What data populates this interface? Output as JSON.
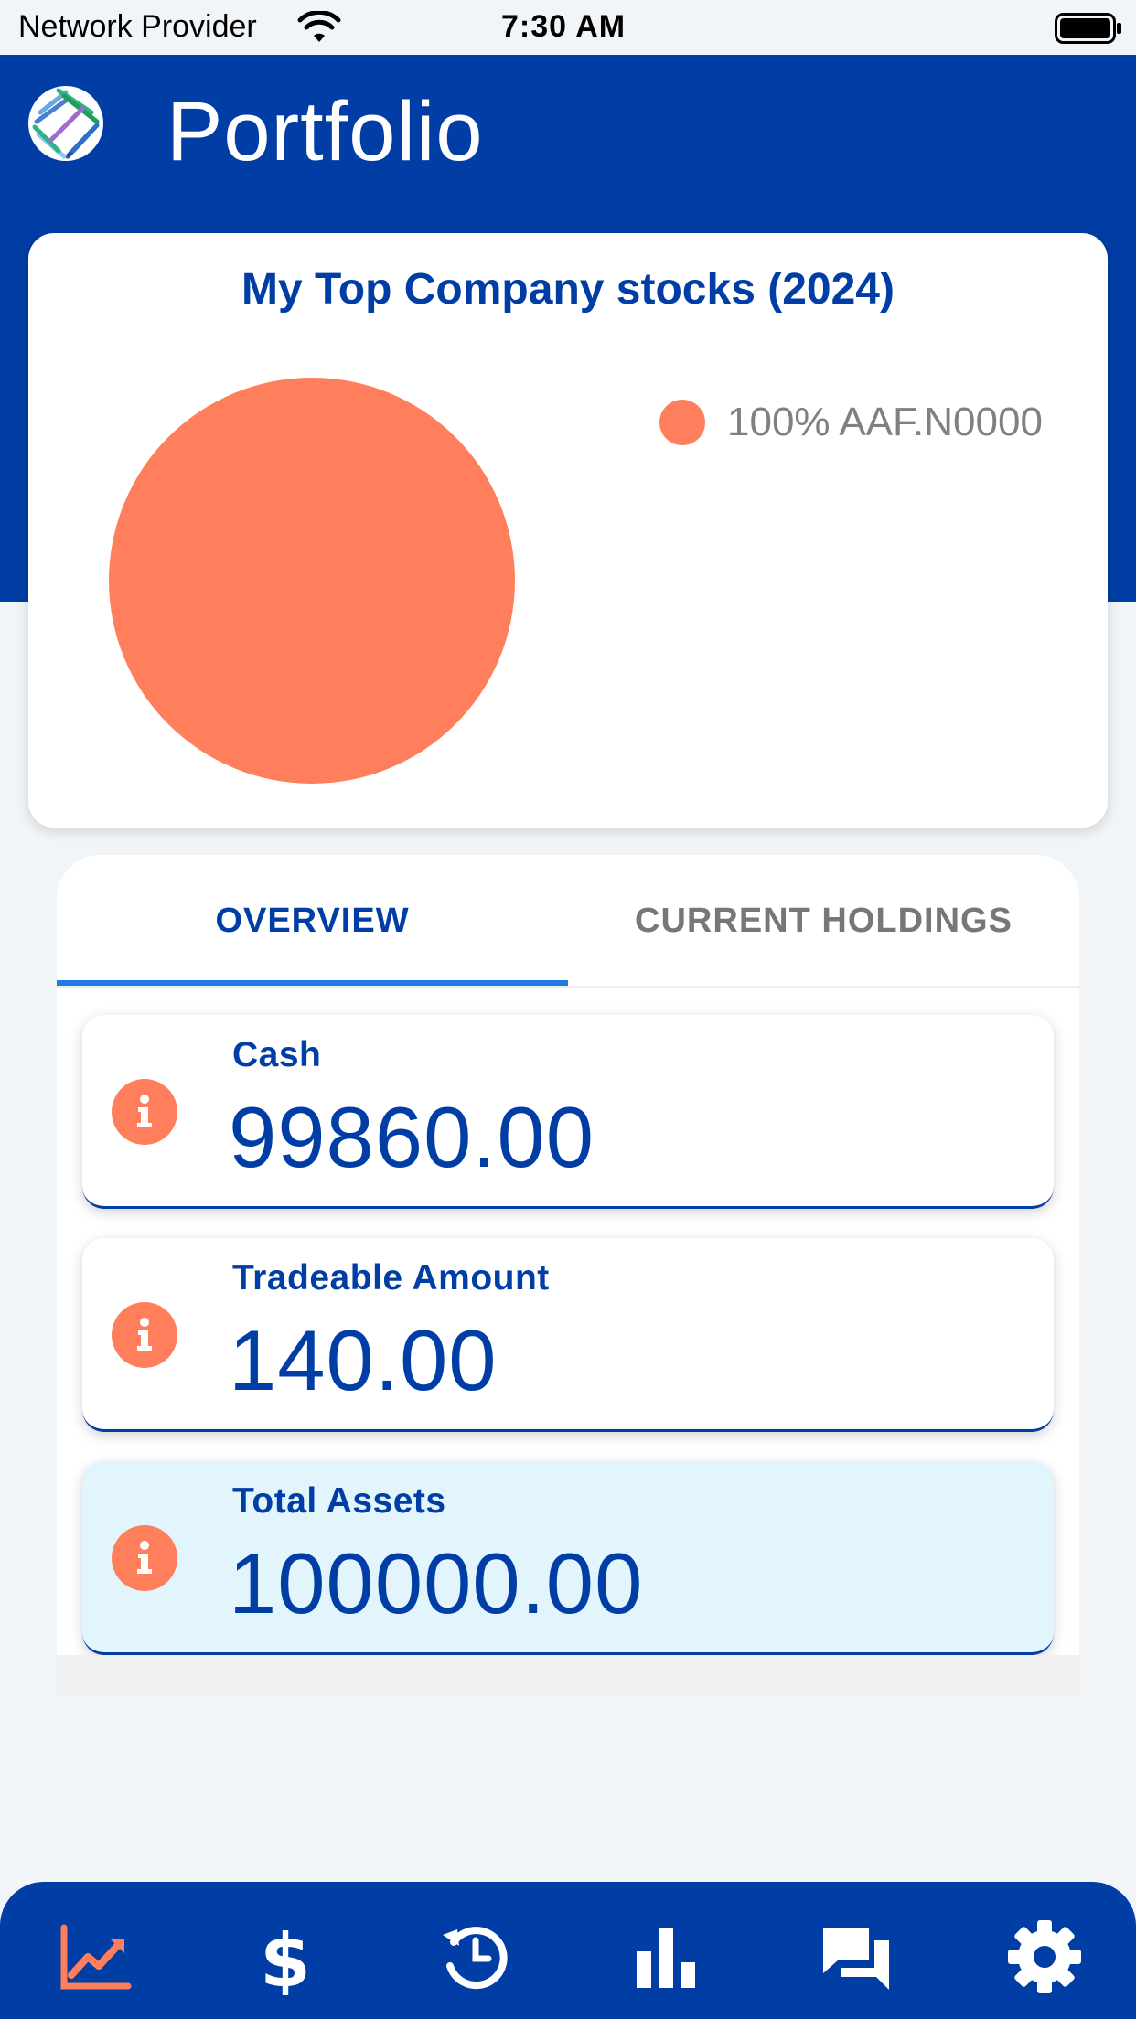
{
  "status_bar": {
    "provider": "Network Provider",
    "time": "7:30 AM"
  },
  "header": {
    "title": "Portfolio",
    "logo_icon": "starburst-logo-icon"
  },
  "chart_data": {
    "type": "pie",
    "title": "My Top Company stocks (2024)",
    "slices": [
      {
        "label": "AAF.N0000",
        "percent": 100,
        "color": "#ff7f5c"
      }
    ],
    "legend_position": "right",
    "legend_entries": [
      "100% AAF.N0000"
    ]
  },
  "tabs": [
    {
      "label": "OVERVIEW",
      "active": true
    },
    {
      "label": "CURRENT HOLDINGS",
      "active": false
    }
  ],
  "stats": [
    {
      "label": "Cash",
      "value": "99860.00",
      "icon": "info-icon"
    },
    {
      "label": "Tradeable Amount",
      "value": "140.00",
      "icon": "info-icon"
    },
    {
      "label": "Total Assets",
      "value": "100000.00",
      "icon": "info-icon"
    }
  ],
  "nav": [
    {
      "name": "portfolio-chart",
      "icon": "trending-chart-icon",
      "active": true
    },
    {
      "name": "trade",
      "icon": "dollar-icon",
      "active": false
    },
    {
      "name": "history",
      "icon": "history-clock-icon",
      "active": false
    },
    {
      "name": "market",
      "icon": "bar-chart-icon",
      "active": false
    },
    {
      "name": "chat",
      "icon": "chat-bubbles-icon",
      "active": false
    },
    {
      "name": "settings",
      "icon": "gear-icon",
      "active": false
    }
  ],
  "colors": {
    "brand_blue": "#003da5",
    "accent_orange": "#ff7f5c",
    "tab_indicator": "#1e7be0",
    "highlight_card": "#e2f4fc"
  }
}
